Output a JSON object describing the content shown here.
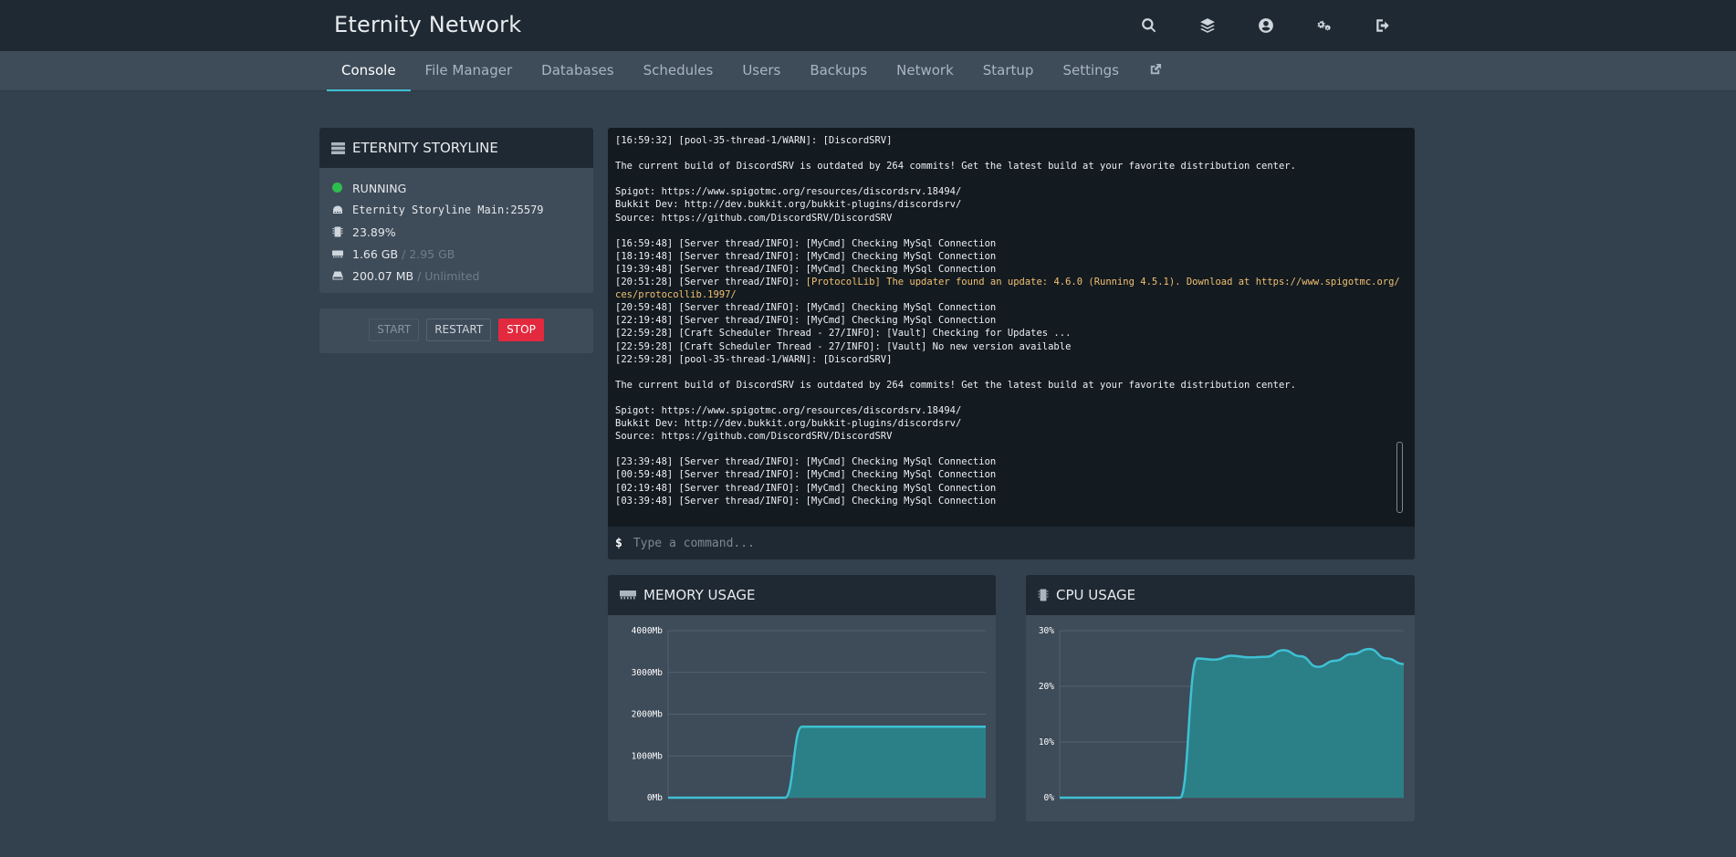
{
  "header": {
    "brand": "Eternity Network",
    "icons": [
      "search-icon",
      "layers-icon",
      "account-icon",
      "settings-icon",
      "logout-icon"
    ]
  },
  "nav": {
    "tabs": [
      {
        "label": "Console",
        "active": true
      },
      {
        "label": "File Manager"
      },
      {
        "label": "Databases"
      },
      {
        "label": "Schedules"
      },
      {
        "label": "Users"
      },
      {
        "label": "Backups"
      },
      {
        "label": "Network"
      },
      {
        "label": "Startup"
      },
      {
        "label": "Settings"
      }
    ],
    "external_icon": "external-link-icon"
  },
  "server": {
    "name": "ETERNITY STORYLINE",
    "status": "RUNNING",
    "address": "Eternity Storyline Main:25579",
    "cpu": "23.89%",
    "memory_used": "1.66 GB",
    "memory_limit": "/ 2.95 GB",
    "disk_used": "200.07 MB",
    "disk_limit": "/ Unlimited"
  },
  "power": {
    "start": "START",
    "restart": "RESTART",
    "stop": "STOP"
  },
  "console": {
    "lines": [
      {
        "text": "[16:59:32] [pool-35-thread-1/WARN]: [DiscordSRV]"
      },
      {
        "text": ""
      },
      {
        "text": "The current build of DiscordSRV is outdated by 264 commits! Get the latest build at your favorite distribution center."
      },
      {
        "text": ""
      },
      {
        "text": "Spigot: https://www.spigotmc.org/resources/discordsrv.18494/"
      },
      {
        "text": "Bukkit Dev: http://dev.bukkit.org/bukkit-plugins/discordsrv/"
      },
      {
        "text": "Source: https://github.com/DiscordSRV/DiscordSRV"
      },
      {
        "text": ""
      },
      {
        "text": "[16:59:48] [Server thread/INFO]: [MyCmd] Checking MySql Connection"
      },
      {
        "text": "[18:19:48] [Server thread/INFO]: [MyCmd] Checking MySql Connection"
      },
      {
        "text": "[19:39:48] [Server thread/INFO]: [MyCmd] Checking MySql Connection"
      },
      {
        "text": "[20:51:28] [Server thread/INFO]: ",
        "warn": "[ProtocolLib] The updater found an update: 4.6.0 (Running 4.5.1). Download at https://www.spigotmc.org/resour"
      },
      {
        "text": "",
        "warn": "ces/protocollib.1997/"
      },
      {
        "text": "[20:59:48] [Server thread/INFO]: [MyCmd] Checking MySql Connection"
      },
      {
        "text": "[22:19:48] [Server thread/INFO]: [MyCmd] Checking MySql Connection"
      },
      {
        "text": "[22:59:28] [Craft Scheduler Thread - 27/INFO]: [Vault] Checking for Updates ..."
      },
      {
        "text": "[22:59:28] [Craft Scheduler Thread - 27/INFO]: [Vault] No new version available"
      },
      {
        "text": "[22:59:28] [pool-35-thread-1/WARN]: [DiscordSRV]"
      },
      {
        "text": ""
      },
      {
        "text": "The current build of DiscordSRV is outdated by 264 commits! Get the latest build at your favorite distribution center."
      },
      {
        "text": ""
      },
      {
        "text": "Spigot: https://www.spigotmc.org/resources/discordsrv.18494/"
      },
      {
        "text": "Bukkit Dev: http://dev.bukkit.org/bukkit-plugins/discordsrv/"
      },
      {
        "text": "Source: https://github.com/DiscordSRV/DiscordSRV"
      },
      {
        "text": ""
      },
      {
        "text": "[23:39:48] [Server thread/INFO]: [MyCmd] Checking MySql Connection"
      },
      {
        "text": "[00:59:48] [Server thread/INFO]: [MyCmd] Checking MySql Connection"
      },
      {
        "text": "[02:19:48] [Server thread/INFO]: [MyCmd] Checking MySql Connection"
      },
      {
        "text": "[03:39:48] [Server thread/INFO]: [MyCmd] Checking MySql Connection"
      }
    ],
    "prompt": "$",
    "placeholder": "Type a command..."
  },
  "memory_chart": {
    "title": "MEMORY USAGE"
  },
  "cpu_chart": {
    "title": "CPU USAGE"
  },
  "colors": {
    "accent": "#3ec1d3",
    "fill": "#2b7f86",
    "stop": "#e3293e",
    "running": "#2dbe4e"
  },
  "chart_data": [
    {
      "type": "area",
      "title": "MEMORY USAGE",
      "ylim": [
        0,
        4000
      ],
      "yticks": [
        "0Mb",
        "1000Mb",
        "2000Mb",
        "3000Mb",
        "4000Mb"
      ],
      "ytick_values": [
        0,
        1000,
        2000,
        3000,
        4000
      ],
      "x": [
        0,
        1,
        2,
        3,
        4,
        5,
        6,
        7,
        8,
        9,
        10,
        11,
        12,
        13,
        14,
        15,
        16,
        17,
        18,
        19
      ],
      "values": [
        0,
        0,
        0,
        0,
        0,
        0,
        0,
        0,
        1700,
        1700,
        1700,
        1700,
        1700,
        1700,
        1700,
        1700,
        1700,
        1700,
        1700,
        1700
      ]
    },
    {
      "type": "area",
      "title": "CPU USAGE",
      "ylim": [
        0,
        30
      ],
      "yticks": [
        "0%",
        "10%",
        "20%",
        "30%"
      ],
      "ytick_values": [
        0,
        10,
        20,
        30
      ],
      "x": [
        0,
        1,
        2,
        3,
        4,
        5,
        6,
        7,
        8,
        9,
        10,
        11,
        12,
        13,
        14,
        15,
        16,
        17,
        18,
        19,
        20
      ],
      "values": [
        0,
        0,
        0,
        0,
        0,
        0,
        0,
        0,
        25,
        24.8,
        25.5,
        25.2,
        25.3,
        26.5,
        25.4,
        23.5,
        24.6,
        25.8,
        26.7,
        25,
        24
      ]
    }
  ]
}
